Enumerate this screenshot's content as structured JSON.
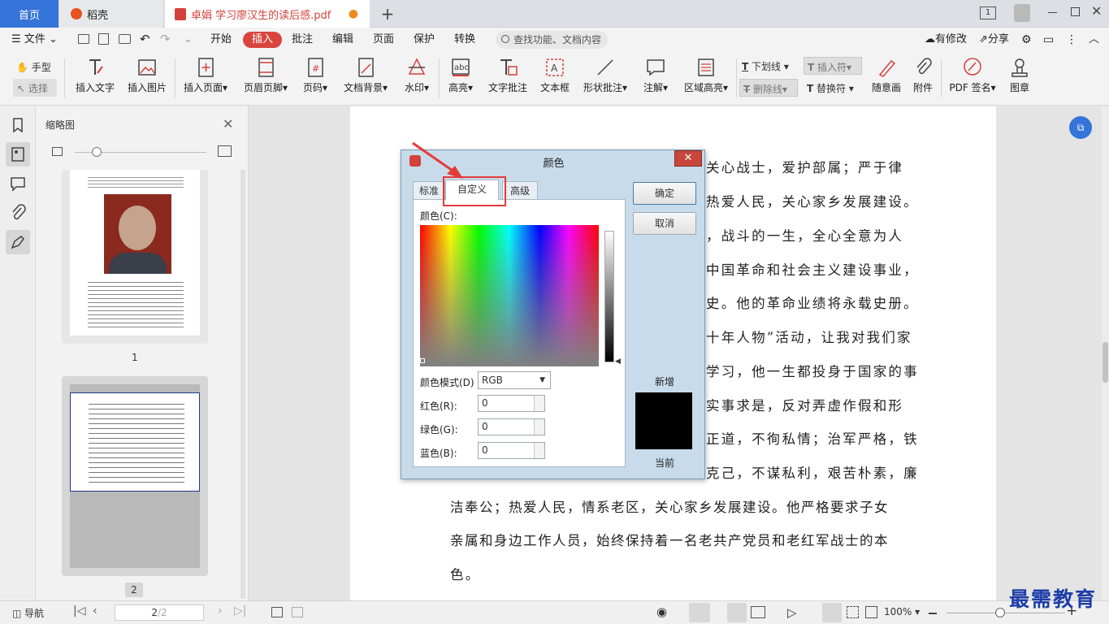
{
  "tabs": {
    "home": "首页",
    "docer": "稻壳",
    "pdf": "卓娟 学习廖汉生的读后感.pdf",
    "add": "+"
  },
  "window": {
    "badge": "1"
  },
  "menubar": {
    "file": "文件",
    "items": [
      "开始",
      "插入",
      "批注",
      "编辑",
      "页面",
      "保护",
      "转换"
    ],
    "search_placeholder": "查找功能、文档内容",
    "right": [
      "有修改",
      "分享"
    ]
  },
  "toolbar": {
    "hand": "手型",
    "select": "选择",
    "tools": [
      "插入文字",
      "插入图片",
      "插入页面",
      "页眉页脚",
      "页码",
      "文档背景",
      "水印",
      "高亮",
      "文字批注",
      "文本框",
      "形状批注",
      "注解",
      "区域高亮"
    ],
    "underline": "下划线",
    "strike": "删除线",
    "insert_mark": "插入符",
    "replace_mark": "替换符",
    "freehand": "随意画",
    "attach": "附件",
    "pdf_sign": "PDF 签名",
    "stamp": "图章"
  },
  "thumbnails": {
    "title": "缩略图",
    "page1_label": "1",
    "page2_label": "2"
  },
  "document": {
    "lines": [
      "关心战士，爱护部属；严于律",
      "热爱人民，关心家乡发展建设。",
      "，战斗的一生，全心全意为人",
      "中国革命和社会主义建设事业，",
      "史。他的革命业绩将永载史册。",
      "十年人物”活动，让我对我们家",
      "学习，他一生都投身于国家的事",
      "实事求是，反对弄虚作假和形",
      "正道，不徇私情；治军严格，铁",
      "克己，不谋私利，艰苦朴素，廉",
      "洁奉公；热爱人民，情系老区，关心家乡发展建设。他严格要求子女",
      "亲属和身边工作人员，始终保持着一名老共产党员和老红军战士的本",
      "色。"
    ]
  },
  "dialog": {
    "title": "颜色",
    "tabs": [
      "标准",
      "自定义",
      "高级"
    ],
    "color_label": "颜色(C):",
    "mode_label": "颜色模式(D)",
    "mode_value": "RGB",
    "red_label": "红色(R):",
    "green_label": "绿色(G):",
    "blue_label": "蓝色(B):",
    "red": "0",
    "green": "0",
    "blue": "0",
    "ok": "确定",
    "cancel": "取消",
    "new": "新增",
    "current": "当前"
  },
  "statusbar": {
    "nav": "导航",
    "page_current": "2",
    "page_total": "/2",
    "zoom": "100%"
  },
  "watermark": "最需教育",
  "colors": {
    "accent": "#3574d8",
    "insert_tab": "#d8453e",
    "highlight_box": "#e33b3b"
  }
}
